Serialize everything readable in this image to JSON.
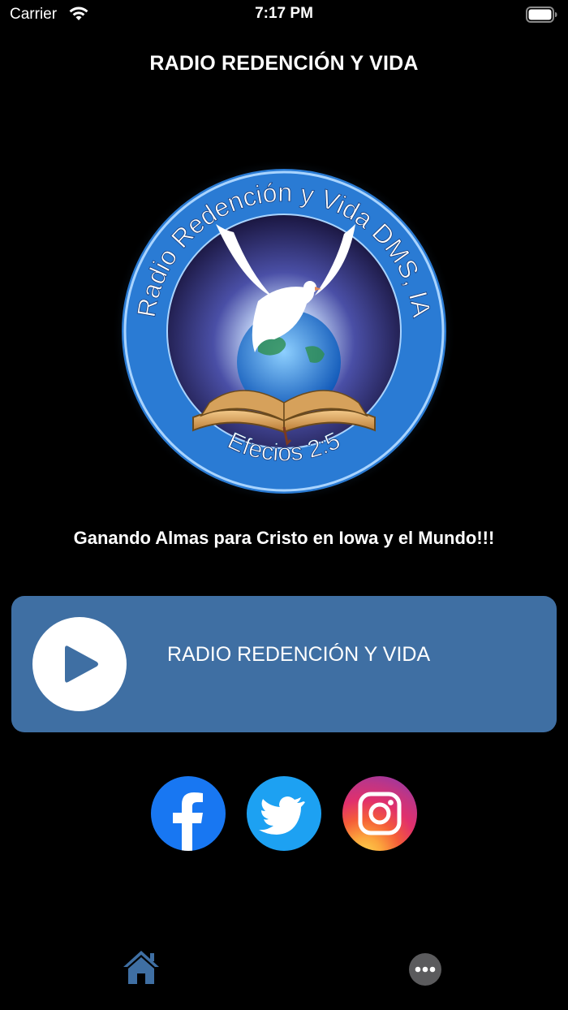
{
  "status_bar": {
    "carrier": "Carrier",
    "time": "7:17 PM",
    "wifi_icon": "wifi-icon",
    "battery_icon": "battery-icon"
  },
  "header": {
    "title": "RADIO REDENCIÓN Y VIDA"
  },
  "logo": {
    "ring_text": "Radio Redención y Vida DMS, IA",
    "bottom_text": "Efecios 2:5"
  },
  "tagline": "Ganando Almas para Cristo en Iowa y el Mundo!!!",
  "player": {
    "play_icon": "play-icon",
    "station_name": "RADIO REDENCIÓN Y VIDA",
    "card_color": "#3f6fa3"
  },
  "social": [
    {
      "name": "Facebook",
      "icon": "facebook-icon",
      "color": "#1877f2"
    },
    {
      "name": "Twitter",
      "icon": "twitter-icon",
      "color": "#1da1f2"
    },
    {
      "name": "Instagram",
      "icon": "instagram-icon",
      "color": "#e1306c"
    }
  ],
  "tab_bar": {
    "items": [
      {
        "icon": "home-icon",
        "active": true,
        "color": "#3f6fa3"
      },
      {
        "icon": "more-icon",
        "active": false,
        "color": "#5b5b5d"
      }
    ]
  }
}
